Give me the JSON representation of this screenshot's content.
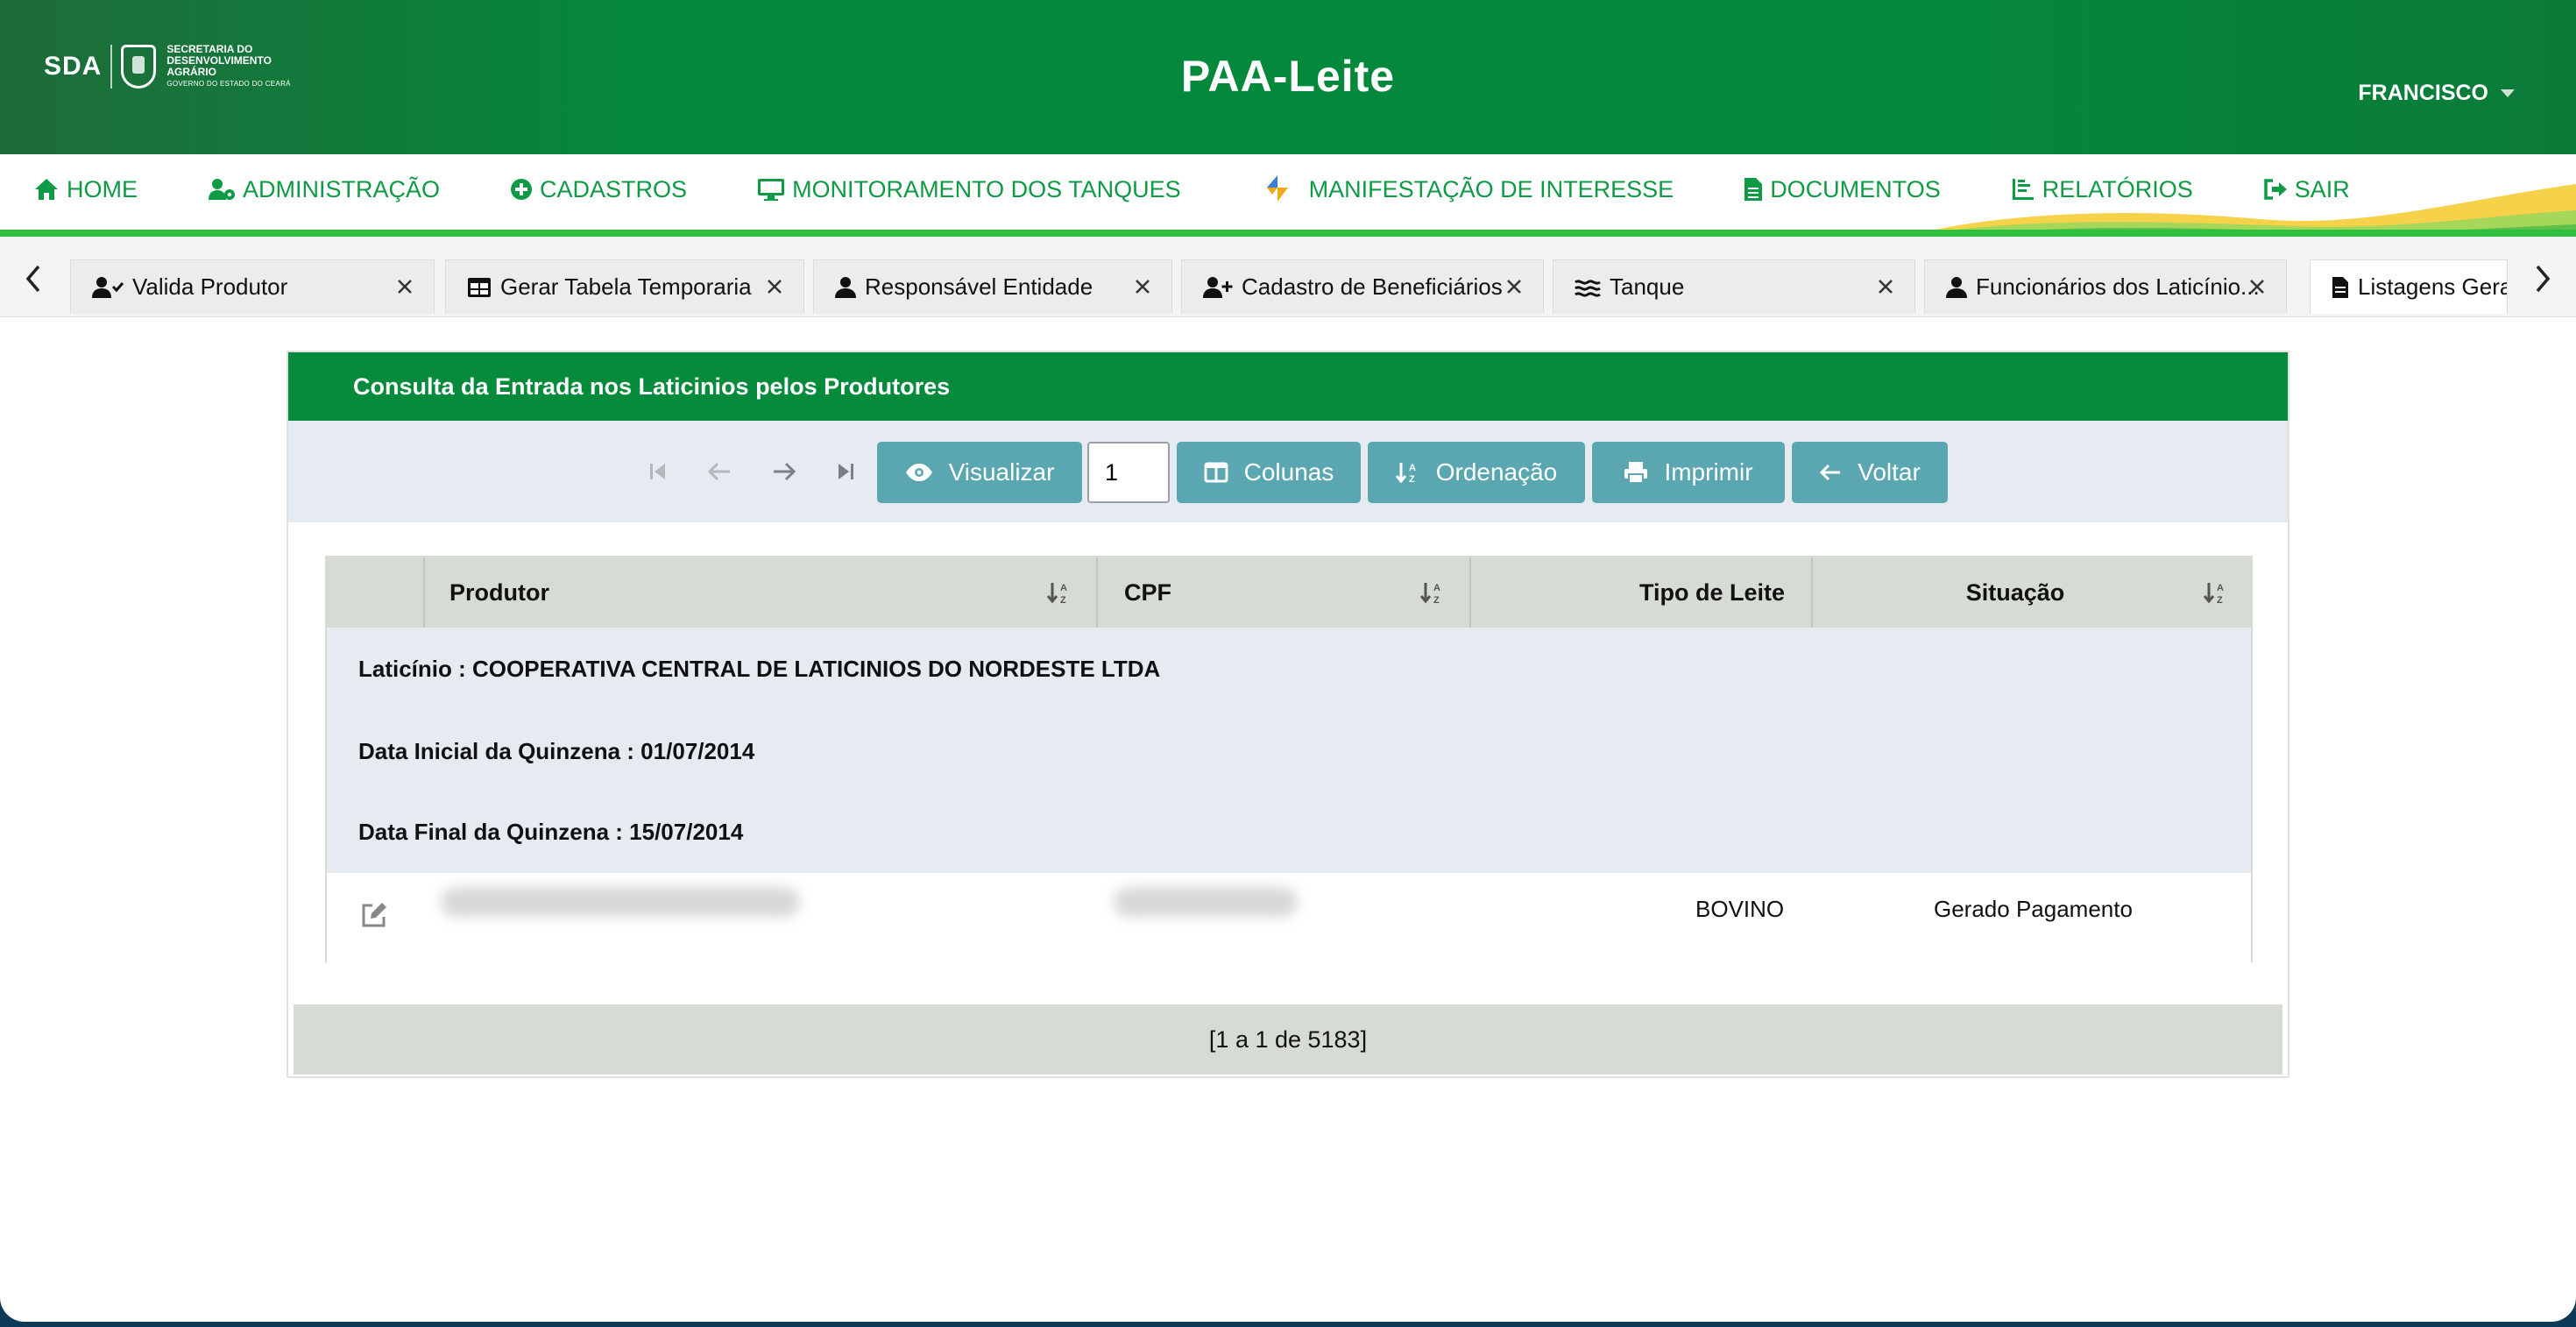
{
  "header": {
    "logo_abbr": "SDA",
    "logo_lines": [
      "SECRETARIA DO",
      "DESENVOLVIMENTO",
      "AGRÁRIO"
    ],
    "logo_sub": "GOVERNO DO ESTADO DO CEARÁ",
    "app_title": "PAA-Leite",
    "user_name": "FRANCISCO"
  },
  "menu": {
    "items": [
      {
        "label": "HOME",
        "icon": "home-icon"
      },
      {
        "label": "ADMINISTRAÇÃO",
        "icon": "user-gear-icon"
      },
      {
        "label": "CADASTROS",
        "icon": "plus-circle-icon"
      },
      {
        "label": "MONITORAMENTO DOS TANQUES",
        "icon": "monitor-icon"
      },
      {
        "label": "MANIFESTAÇÃO DE INTERESSE",
        "icon": "code-brand-icon"
      },
      {
        "label": "DOCUMENTOS",
        "icon": "document-icon"
      },
      {
        "label": "RELATÓRIOS",
        "icon": "chart-icon"
      },
      {
        "label": "SAIR",
        "icon": "sign-out-icon"
      }
    ]
  },
  "tabs": [
    {
      "label": "Valida Produtor",
      "icon": "user-check-icon"
    },
    {
      "label": "Gerar Tabela Temporaria",
      "icon": "table-icon"
    },
    {
      "label": "Responsável Entidade",
      "icon": "user-icon"
    },
    {
      "label": "Cadastro de Beneficiários",
      "icon": "user-plus-icon"
    },
    {
      "label": "Tanque",
      "icon": "water-icon"
    },
    {
      "label": "Funcionários dos Laticínio...",
      "icon": "user-icon"
    },
    {
      "label": "Listagens Gera",
      "icon": "file-icon"
    }
  ],
  "panel": {
    "title": "Consulta da Entrada nos Laticinios pelos Produtores",
    "page_value": "1",
    "buttons": {
      "view": "Visualizar",
      "columns": "Colunas",
      "sort": "Ordenação",
      "print": "Imprimir",
      "back": "Voltar"
    },
    "columns": [
      "Produtor",
      "CPF",
      "Tipo de Leite",
      "Situação"
    ],
    "group": {
      "laticinio": "Laticínio : COOPERATIVA CENTRAL DE LATICINIOS DO NORDESTE LTDA",
      "data_inicial": "Data Inicial da Quinzena : 01/07/2014",
      "data_final": "Data Final da Quinzena : 15/07/2014"
    },
    "rows": [
      {
        "tipo_leite": "BOVINO",
        "situacao": "Gerado Pagamento"
      }
    ],
    "footer": "[1 a 1 de 5183]"
  },
  "colors": {
    "header_green": "#04883c",
    "menu_text": "#0f9a45",
    "button_teal": "#5ba7b1",
    "panel_head": "#068a3c"
  }
}
